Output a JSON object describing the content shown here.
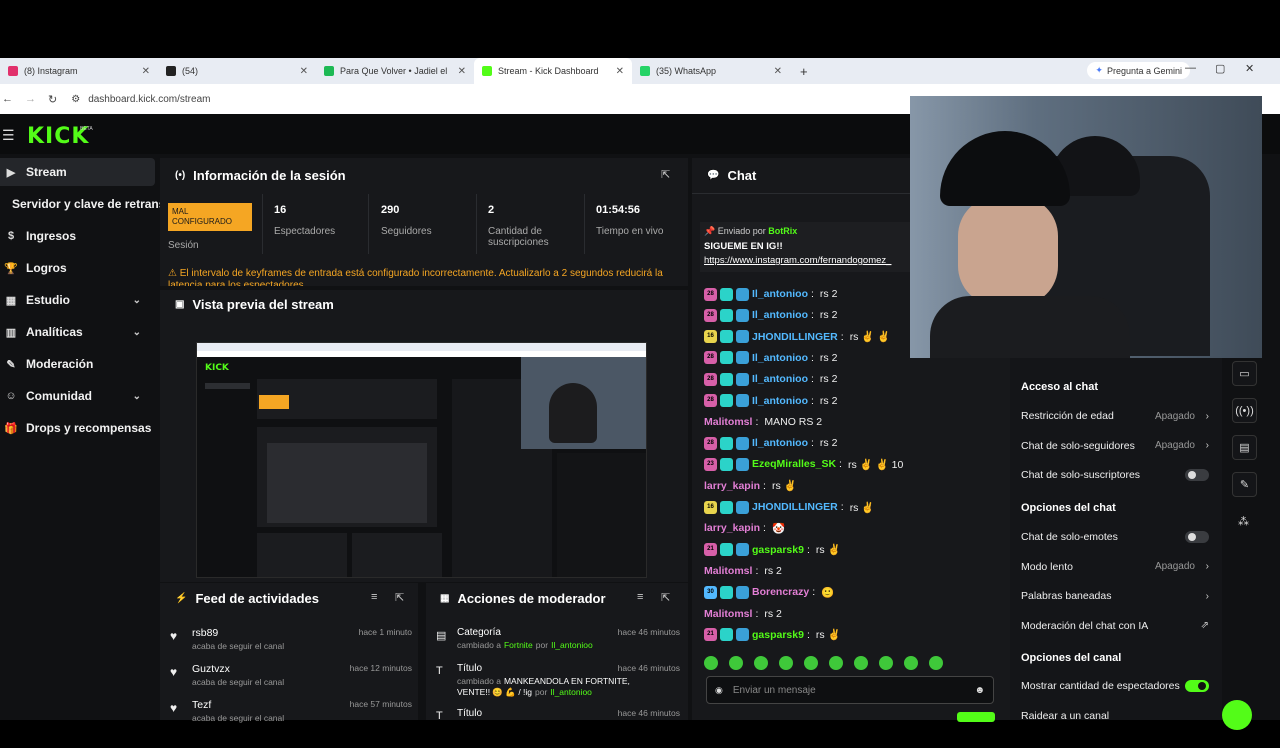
{
  "browser": {
    "tabs": [
      {
        "label": "(8) Instagram",
        "color": "#e1306c"
      },
      {
        "label": "(54)",
        "color": "#222222"
      },
      {
        "label": "Para Que Volver • Jadiel el I",
        "color": "#1db954"
      },
      {
        "label": "Stream - Kick Dashboard",
        "color": "#53fc18"
      },
      {
        "label": "(35) WhatsApp",
        "color": "#25d366"
      }
    ],
    "new_tab": "+",
    "url": "dashboard.kick.com/stream",
    "gemini_label": "Pregunta a Gemini"
  },
  "app": {
    "logo": "KICK",
    "beta": "BETA",
    "accent": "#53fc18"
  },
  "sidebar": {
    "items": [
      {
        "label": "Stream",
        "icon": "video-icon"
      },
      {
        "label": "Servidor y clave de retransn",
        "icon": ""
      },
      {
        "label": "Ingresos",
        "icon": "money-icon"
      },
      {
        "label": "Logros",
        "icon": "trophy-icon"
      },
      {
        "label": "Estudio",
        "icon": "studio-icon"
      },
      {
        "label": "Analíticas",
        "icon": "chart-icon"
      },
      {
        "label": "Moderación",
        "icon": "wrench-icon"
      },
      {
        "label": "Comunidad",
        "icon": "users-icon"
      },
      {
        "label": "Drops y recompensas",
        "icon": "gift-icon"
      }
    ]
  },
  "session": {
    "title": "Información de la sesión",
    "status_badge": "MAL CONFIGURADO",
    "status_label": "Sesión",
    "stats": [
      {
        "value": "16",
        "label": "Espectadores"
      },
      {
        "value": "290",
        "label": "Seguidores"
      },
      {
        "value": "2",
        "label": "Cantidad de suscripciones"
      },
      {
        "value": "01:54:56",
        "label": "Tiempo en vivo"
      }
    ],
    "warning": "El intervalo de keyframes de entrada está configurado incorrectamente. Actualizarlo a 2 segundos reducirá la latencia para los espectadores."
  },
  "preview": {
    "title": "Vista previa del stream"
  },
  "feed": {
    "title": "Feed de actividades",
    "items": [
      {
        "name": "rsb89",
        "sub": "acaba de seguir el canal",
        "time": "hace 1 minuto"
      },
      {
        "name": "Guztvzx",
        "sub": "acaba de seguir el canal",
        "time": "hace 12 minutos"
      },
      {
        "name": "Tezf",
        "sub": "acaba de seguir el canal",
        "time": "hace 57 minutos"
      }
    ]
  },
  "modactions": {
    "title": "Acciones de moderador",
    "items": [
      {
        "name": "Categoría",
        "sub_prefix": "cambiado a",
        "sub_value": "Fortnite",
        "sub_by": "por",
        "user": "Il_antonioo",
        "time": "hace 46 minutos"
      },
      {
        "name": "Título",
        "sub_prefix": "cambiado a",
        "sub_value": "MANKEANDOLA EN FORTNITE, VENTE!! 😊 💪 / !ig",
        "sub_by": "por",
        "user": "Il_antonioo",
        "time": "hace 46 minutos"
      },
      {
        "name": "Título",
        "sub_prefix": "",
        "sub_value": "",
        "sub_by": "",
        "user": "",
        "time": "hace 46 minutos"
      }
    ]
  },
  "chat": {
    "title": "Chat",
    "pinned_by": "Enviado por",
    "pinned_user": "BotRix",
    "pinned_text": "SIGUEME EN IG!!",
    "pinned_link": "https://www.instagram.com/fernandogomez_",
    "messages": [
      {
        "badge": "28",
        "badge_color": "#d75fa8",
        "user": "Il_antonioo",
        "user_color": "#53b9ff",
        "text": "rs 2"
      },
      {
        "badge": "28",
        "badge_color": "#d75fa8",
        "user": "Il_antonioo",
        "user_color": "#53b9ff",
        "text": "rs 2"
      },
      {
        "badge": "16",
        "badge_color": "#e8d44d",
        "user": "JHONDILLINGER",
        "user_color": "#53b9ff",
        "text": "rs ✌️ ✌️"
      },
      {
        "badge": "28",
        "badge_color": "#d75fa8",
        "user": "Il_antonioo",
        "user_color": "#53b9ff",
        "text": "rs 2"
      },
      {
        "badge": "28",
        "badge_color": "#d75fa8",
        "user": "Il_antonioo",
        "user_color": "#53b9ff",
        "text": "rs 2"
      },
      {
        "badge": "28",
        "badge_color": "#d75fa8",
        "user": "Il_antonioo",
        "user_color": "#53b9ff",
        "text": "rs 2"
      },
      {
        "badge": "",
        "badge_color": "",
        "user": "Malitomsl",
        "user_color": "#e37fd5",
        "text": "MANO RS 2"
      },
      {
        "badge": "28",
        "badge_color": "#d75fa8",
        "user": "Il_antonioo",
        "user_color": "#53b9ff",
        "text": "rs 2"
      },
      {
        "badge": "23",
        "badge_color": "#d75fa8",
        "user": "EzeqMiralles_SK",
        "user_color": "#53fc18",
        "text": "rs ✌️ ✌️ 10"
      },
      {
        "badge": "",
        "badge_color": "",
        "user": "larry_kapin",
        "user_color": "#e37fd5",
        "text": "rs ✌️"
      },
      {
        "badge": "16",
        "badge_color": "#e8d44d",
        "user": "JHONDILLINGER",
        "user_color": "#53b9ff",
        "text": "rs ✌️"
      },
      {
        "badge": "",
        "badge_color": "",
        "user": "larry_kapin",
        "user_color": "#e37fd5",
        "text": "🤡"
      },
      {
        "badge": "21",
        "badge_color": "#d75fa8",
        "user": "gasparsk9",
        "user_color": "#53fc18",
        "text": "rs ✌️"
      },
      {
        "badge": "",
        "badge_color": "",
        "user": "Malitomsl",
        "user_color": "#e37fd5",
        "text": "rs 2"
      },
      {
        "badge": "30",
        "badge_color": "#53b9ff",
        "user": "Borencrazy",
        "user_color": "#e37fd5",
        "text": "🙂"
      },
      {
        "badge": "",
        "badge_color": "",
        "user": "Malitomsl",
        "user_color": "#e37fd5",
        "text": "rs 2"
      },
      {
        "badge": "21",
        "badge_color": "#d75fa8",
        "user": "gasparsk9",
        "user_color": "#53fc18",
        "text": "rs ✌️"
      }
    ],
    "input_placeholder": "Enviar un mensaje"
  },
  "settings": {
    "section1": "Acceso al chat",
    "rows1": [
      {
        "label": "Restricción de edad",
        "value": "Apagado",
        "kind": "chevron"
      },
      {
        "label": "Chat de solo-seguidores",
        "value": "Apagado",
        "kind": "chevron"
      },
      {
        "label": "Chat de solo-suscriptores",
        "value": "",
        "kind": "toggle-off"
      }
    ],
    "section2": "Opciones del chat",
    "rows2": [
      {
        "label": "Chat de solo-emotes",
        "value": "",
        "kind": "toggle-off"
      },
      {
        "label": "Modo lento",
        "value": "Apagado",
        "kind": "chevron"
      },
      {
        "label": "Palabras baneadas",
        "value": "",
        "kind": "chevron"
      },
      {
        "label": "Moderación del chat con IA",
        "value": "",
        "kind": "external"
      }
    ],
    "section3": "Opciones del canal",
    "rows3": [
      {
        "label": "Mostrar cantidad de espectadores",
        "value": "",
        "kind": "toggle-on"
      },
      {
        "label": "Raidear a un canal",
        "value": "",
        "kind": "none"
      }
    ]
  }
}
